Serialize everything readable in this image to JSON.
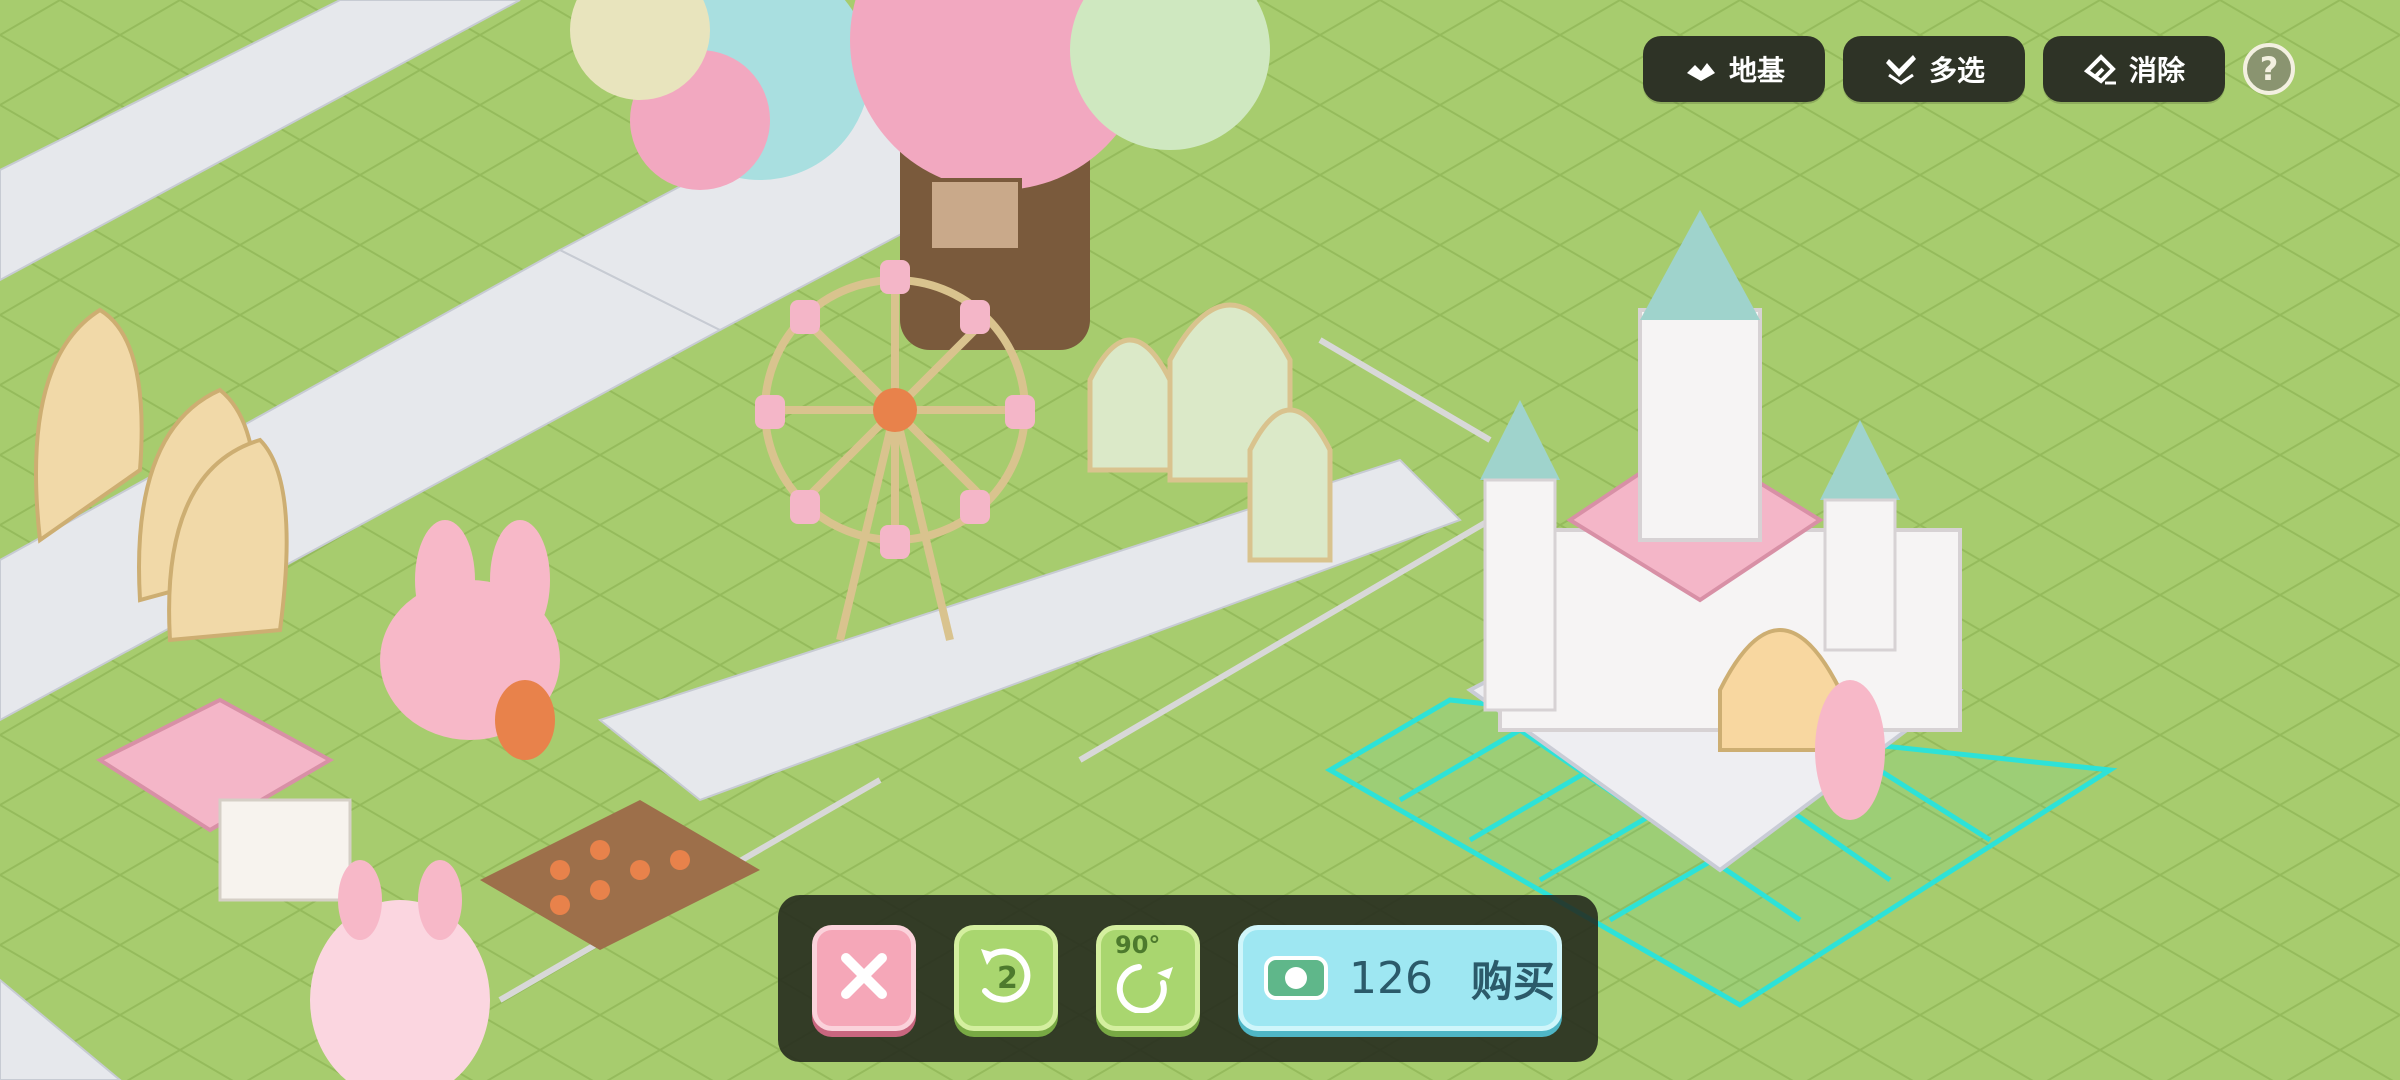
{
  "toolbar": {
    "foundation_label": "地基",
    "multiselect_label": "多选",
    "erase_label": "消除",
    "help_label": "?"
  },
  "bottom_bar": {
    "undo_count": "2",
    "rotate_label": "90°",
    "price": "126",
    "buy_label": "购买"
  },
  "colors": {
    "grass": "#a7cc6e",
    "toolbar_bg": "#2e3326",
    "cancel": "#f5a7b8",
    "green_btn": "#a9d66f",
    "buy_btn": "#9ee7f2",
    "placement_grid": "#2de2d8"
  },
  "icons": [
    "foundation-icon",
    "multiselect-icon",
    "eraser-icon",
    "help-icon",
    "close-icon",
    "undo-icon",
    "rotate-icon",
    "coin-icon"
  ]
}
